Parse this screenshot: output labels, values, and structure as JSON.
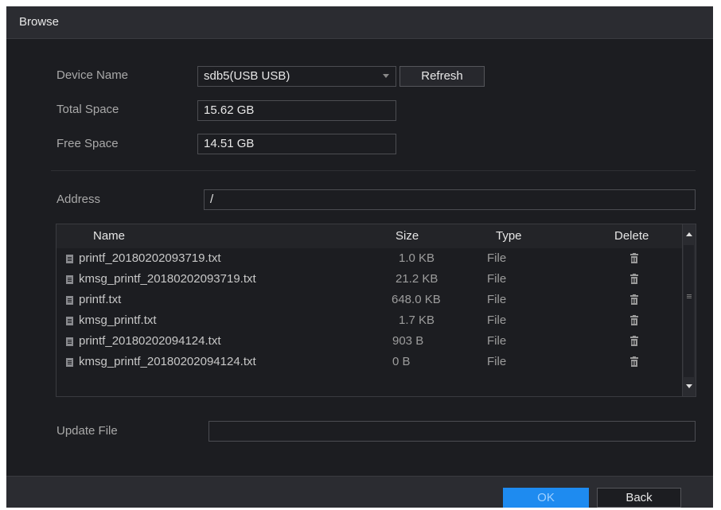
{
  "dialog": {
    "title": "Browse"
  },
  "device": {
    "device_name_label": "Device Name",
    "device_name_value": "sdb5(USB USB)",
    "refresh_label": "Refresh",
    "total_space_label": "Total Space",
    "total_space_value": "15.62 GB",
    "free_space_label": "Free Space",
    "free_space_value": "14.51 GB"
  },
  "address": {
    "label": "Address",
    "value": "/"
  },
  "table": {
    "columns": {
      "name": "Name",
      "size": "Size",
      "type": "Type",
      "delete": "Delete"
    },
    "rows": [
      {
        "name": "printf_20180202093719.txt",
        "size": "1.0 KB",
        "type": "File"
      },
      {
        "name": "kmsg_printf_20180202093719.txt",
        "size": "21.2 KB",
        "type": "File"
      },
      {
        "name": "printf.txt",
        "size": "648.0 KB",
        "type": "File"
      },
      {
        "name": "kmsg_printf.txt",
        "size": "1.7 KB",
        "type": "File"
      },
      {
        "name": "printf_20180202094124.txt",
        "size": "903 B",
        "type": "File"
      },
      {
        "name": "kmsg_printf_20180202094124.txt",
        "size": "0 B",
        "type": "File"
      }
    ]
  },
  "update": {
    "label": "Update File",
    "value": ""
  },
  "footer": {
    "ok_label": "OK",
    "back_label": "Back"
  },
  "colors": {
    "background": "#1c1d21",
    "primary_button": "#1e8bf0"
  },
  "icons": {
    "file": "file-icon",
    "delete": "trash-icon",
    "dropdown": "chevron-down-icon"
  }
}
